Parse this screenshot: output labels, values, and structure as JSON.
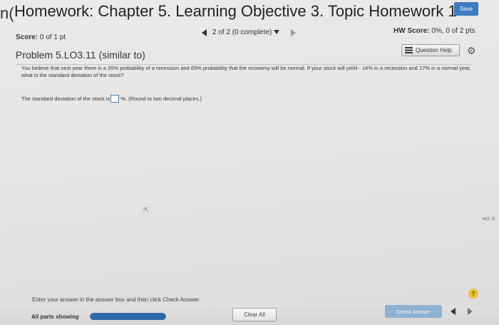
{
  "header": {
    "left_cut_text": "n(",
    "title": "Homework: Chapter 5. Learning Objective 3. Topic Homework 1",
    "save_label": "Save"
  },
  "score": {
    "label": "Score:",
    "value": "0 of 1 pt"
  },
  "nav": {
    "position": "2 of 2 (0 complete)"
  },
  "hw_score": {
    "label": "HW Score:",
    "value": "0%, 0 of 2 pts"
  },
  "problem": {
    "title": "Problem 5.LO3.11 (similar to)",
    "question_help_label": "Question Help",
    "text": "You believe that next year there is a 35% probability of a recession and 65% probability that the economy will be normal. If your stock will yield - 14% in a recession and 17% in a normal year, what is the standard deviation of the stock?",
    "ask_prefix": "The standard deviation of the stock is",
    "ask_suffix": "%. (Round to two decimal places.)",
    "answer_value": ""
  },
  "side_cut_text": "ect: 0",
  "footer": {
    "instruction": "Enter your answer in the answer box and then click Check Answer.",
    "all_parts_label": "All parts showing",
    "progress_fraction": 1.0,
    "clear_all_label": "Clear All",
    "check_answer_label": "Check Answer",
    "help_symbol": "?"
  },
  "colors": {
    "accent": "#3b7bbf",
    "progress": "#2f68a8",
    "help": "#e8c23a"
  },
  "icons": {
    "list": "list-icon",
    "gear": "gear-icon",
    "help": "question-icon",
    "cursor": "cursor-icon"
  }
}
